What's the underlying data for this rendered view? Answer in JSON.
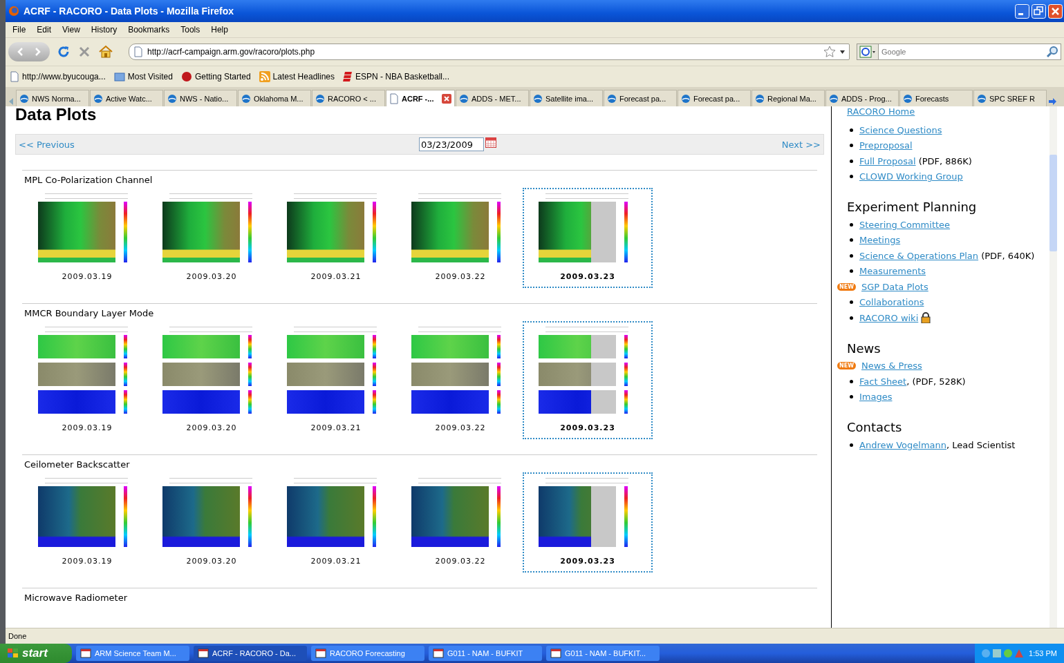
{
  "window": {
    "title": "ACRF - RACORO - Data Plots - Mozilla Firefox"
  },
  "menu": [
    "File",
    "Edit",
    "View",
    "History",
    "Bookmarks",
    "Tools",
    "Help"
  ],
  "address_bar": {
    "url": "http://acrf-campaign.arm.gov/racoro/plots.php"
  },
  "search": {
    "placeholder": "Google"
  },
  "bookmarks": [
    "http://www.byucouga...",
    "Most Visited",
    "Getting Started",
    "Latest Headlines",
    "ESPN - NBA Basketball..."
  ],
  "tabs": [
    {
      "label": "NWS Norma...",
      "selected": false
    },
    {
      "label": "Active Watc...",
      "selected": false
    },
    {
      "label": "NWS - Natio...",
      "selected": false
    },
    {
      "label": "Oklahoma M...",
      "selected": false
    },
    {
      "label": "RACORO < ...",
      "selected": false
    },
    {
      "label": "ACRF -...",
      "selected": true
    },
    {
      "label": "ADDS - MET...",
      "selected": false
    },
    {
      "label": "Satellite ima...",
      "selected": false
    },
    {
      "label": "Forecast pa...",
      "selected": false
    },
    {
      "label": "Forecast pa...",
      "selected": false
    },
    {
      "label": "Regional Ma...",
      "selected": false
    },
    {
      "label": "ADDS - Prog...",
      "selected": false
    },
    {
      "label": "Forecasts",
      "selected": false
    },
    {
      "label": "SPC SREF R",
      "selected": false
    }
  ],
  "page": {
    "title": "Data Plots",
    "previous": "<< Previous",
    "date": "03/23/2009",
    "next": "Next >>",
    "sections": [
      {
        "title": "MPL Co-Polarization Channel",
        "kind": "lidar",
        "plots": [
          {
            "date": "2009.03.19",
            "selected": false,
            "partial": false
          },
          {
            "date": "2009.03.20",
            "selected": false,
            "partial": false
          },
          {
            "date": "2009.03.21",
            "selected": false,
            "partial": false
          },
          {
            "date": "2009.03.22",
            "selected": false,
            "partial": false
          },
          {
            "date": "2009.03.23",
            "selected": true,
            "partial": true
          }
        ]
      },
      {
        "title": "MMCR Boundary Layer Mode",
        "kind": "radar",
        "plots": [
          {
            "date": "2009.03.19",
            "selected": false,
            "partial": false
          },
          {
            "date": "2009.03.20",
            "selected": false,
            "partial": false
          },
          {
            "date": "2009.03.21",
            "selected": false,
            "partial": false
          },
          {
            "date": "2009.03.22",
            "selected": false,
            "partial": false
          },
          {
            "date": "2009.03.23",
            "selected": true,
            "partial": true
          }
        ]
      },
      {
        "title": "Ceilometer Backscatter",
        "kind": "ceilometer",
        "plots": [
          {
            "date": "2009.03.19",
            "selected": false,
            "partial": false
          },
          {
            "date": "2009.03.20",
            "selected": false,
            "partial": false
          },
          {
            "date": "2009.03.21",
            "selected": false,
            "partial": false
          },
          {
            "date": "2009.03.22",
            "selected": false,
            "partial": false
          },
          {
            "date": "2009.03.23",
            "selected": true,
            "partial": true
          }
        ]
      },
      {
        "title": "Microwave Radiometer"
      }
    ]
  },
  "sidebar": {
    "top_link": "RACORO Home",
    "groups": [
      {
        "items": [
          {
            "link": "Science Questions"
          },
          {
            "link": "Preproposal"
          },
          {
            "link": "Full Proposal",
            "note": " (PDF, 886K)"
          },
          {
            "link": "CLOWD Working Group"
          }
        ]
      },
      {
        "heading": "Experiment Planning",
        "items": [
          {
            "link": "Steering Committee"
          },
          {
            "link": "Meetings"
          },
          {
            "link": "Science & Operations Plan",
            "note": " (PDF, 640K)"
          },
          {
            "link": "Measurements"
          },
          {
            "link": "SGP Data Plots",
            "badge": "NEW"
          },
          {
            "link": "Collaborations"
          },
          {
            "link": "RACORO wiki",
            "locked": true
          }
        ]
      },
      {
        "heading": "News",
        "items": [
          {
            "link": "News & Press",
            "badge": "NEW"
          },
          {
            "link": "Fact Sheet",
            "note": ", (PDF, 528K)"
          },
          {
            "link": "Images"
          }
        ]
      },
      {
        "heading": "Contacts",
        "items": [
          {
            "link": "Andrew Vogelmann",
            "note": ", Lead Scientist"
          }
        ]
      }
    ]
  },
  "status_bar": "Done",
  "taskbar": {
    "start": "start",
    "tasks": [
      {
        "label": "ARM Science Team M...",
        "selected": false
      },
      {
        "label": "ACRF - RACORO - Da...",
        "selected": true
      },
      {
        "label": "RACORO Forecasting",
        "selected": false
      },
      {
        "label": "G011 - NAM - BUFKIT",
        "selected": false
      },
      {
        "label": "G011 - NAM - BUFKIT...",
        "selected": false
      }
    ],
    "clock": "1:53 PM"
  }
}
